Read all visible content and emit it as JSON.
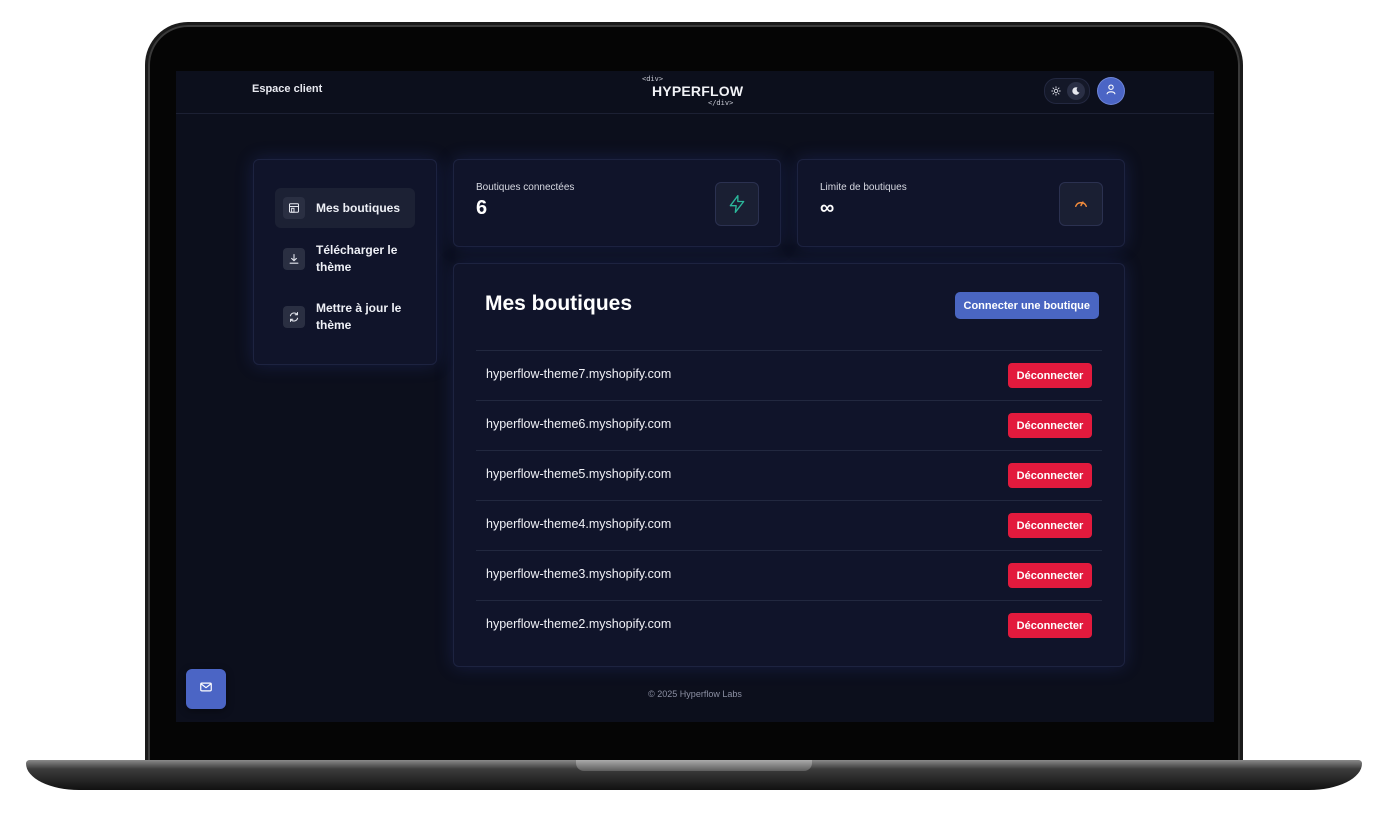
{
  "header": {
    "title": "Espace client",
    "logo": {
      "open_tag": "<div>",
      "name": "HYPERFLOW",
      "close_tag": "</div>"
    },
    "theme_toggle": {
      "light_icon": "sun-icon",
      "dark_icon": "moon-icon",
      "selected": "dark"
    },
    "avatar_icon": "user-icon"
  },
  "sidebar": {
    "items": [
      {
        "label": "Mes boutiques",
        "icon": "store-icon",
        "active": true
      },
      {
        "label": "Télécharger le thème",
        "icon": "download-icon",
        "active": false
      },
      {
        "label": "Mettre à jour le thème",
        "icon": "refresh-icon",
        "active": false
      }
    ]
  },
  "stats": {
    "connected": {
      "label": "Boutiques connectées",
      "value": "6",
      "icon": "lightning-icon",
      "icon_color": "#2bb79b"
    },
    "limit": {
      "label": "Limite de boutiques",
      "value": "∞",
      "icon": "gauge-icon",
      "icon_color": "#f08a3c"
    }
  },
  "shops": {
    "title": "Mes boutiques",
    "connect_label": "Connecter une boutique",
    "disconnect_label": "Déconnecter",
    "items": [
      "hyperflow-theme7.myshopify.com",
      "hyperflow-theme6.myshopify.com",
      "hyperflow-theme5.myshopify.com",
      "hyperflow-theme4.myshopify.com",
      "hyperflow-theme3.myshopify.com",
      "hyperflow-theme2.myshopify.com"
    ]
  },
  "footer": {
    "text": "© 2025 Hyperflow Labs"
  },
  "contact_button_icon": "mail-icon",
  "colors": {
    "accent": "#4a66c2",
    "danger": "#e21a3d",
    "background": "#0c0f1c"
  }
}
